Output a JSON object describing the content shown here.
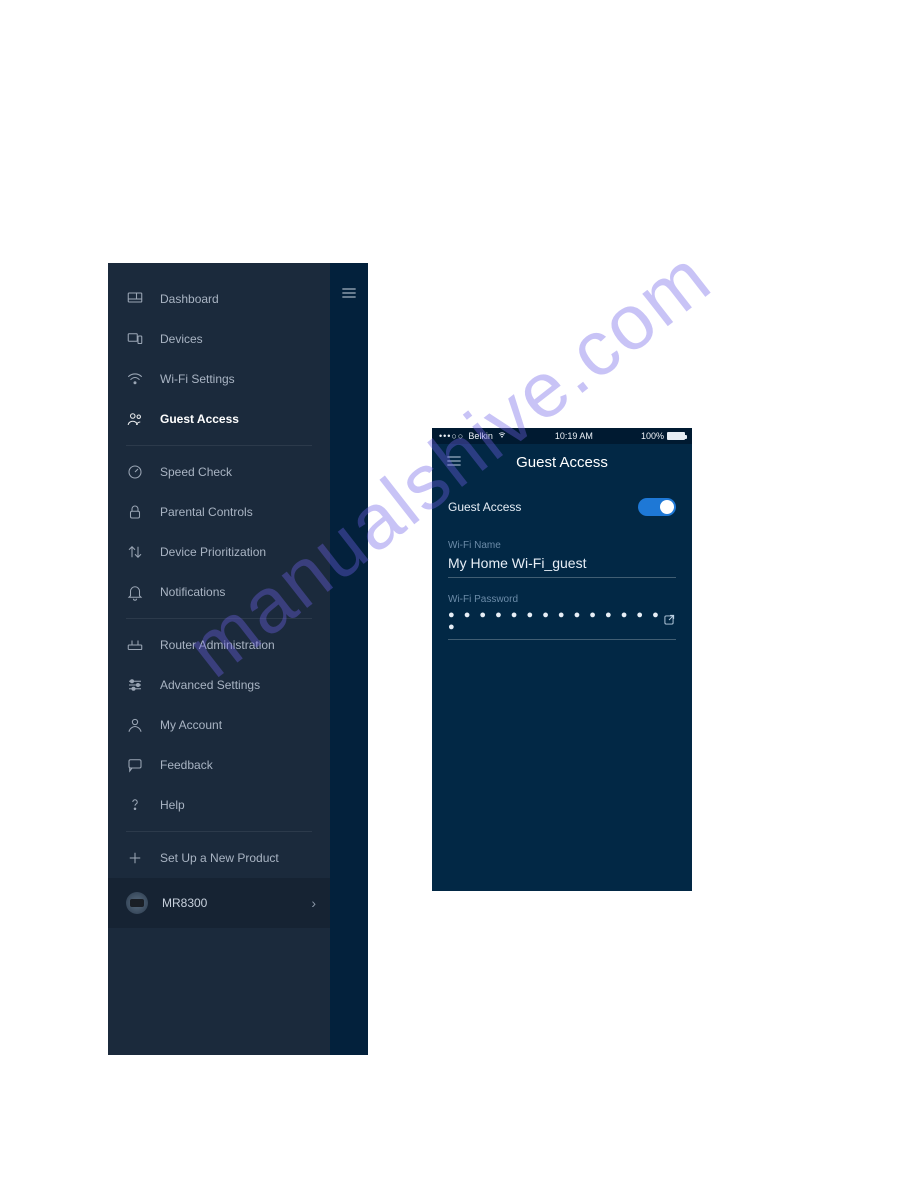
{
  "sidebar": {
    "groups": [
      {
        "id": "dashboard",
        "icon": "dashboard",
        "label": "Dashboard",
        "active": false
      },
      {
        "id": "devices",
        "icon": "devices",
        "label": "Devices",
        "active": false
      },
      {
        "id": "wifi",
        "icon": "wifi",
        "label": "Wi-Fi Settings",
        "active": false
      },
      {
        "id": "guest",
        "icon": "people",
        "label": "Guest Access",
        "active": true
      }
    ],
    "tools": [
      {
        "id": "speed",
        "icon": "gauge",
        "label": "Speed Check"
      },
      {
        "id": "parental",
        "icon": "lock",
        "label": "Parental Controls"
      },
      {
        "id": "priority",
        "icon": "updown",
        "label": "Device Prioritization"
      },
      {
        "id": "notifications",
        "icon": "bell",
        "label": "Notifications"
      }
    ],
    "admin": [
      {
        "id": "router",
        "icon": "router",
        "label": "Router Administration"
      },
      {
        "id": "advanced",
        "icon": "sliders",
        "label": "Advanced Settings"
      },
      {
        "id": "account",
        "icon": "person",
        "label": "My Account"
      },
      {
        "id": "feedback",
        "icon": "chat",
        "label": "Feedback"
      },
      {
        "id": "help",
        "icon": "help",
        "label": "Help"
      }
    ],
    "setup": {
      "icon": "plus",
      "label": "Set Up a New Product"
    },
    "product": {
      "name": "MR8300"
    }
  },
  "guest_screen": {
    "statusbar": {
      "carrier": "Belkin",
      "time": "10:19 AM",
      "battery": "100%"
    },
    "title": "Guest Access",
    "toggle_label": "Guest Access",
    "toggle_on": true,
    "wifi_name_label": "Wi-Fi Name",
    "wifi_name_value": "My Home Wi-Fi_guest",
    "wifi_password_label": "Wi-Fi Password",
    "wifi_password_masked": "● ● ● ● ● ● ● ● ● ● ● ● ● ● ●"
  },
  "watermark": "manualshive.com"
}
